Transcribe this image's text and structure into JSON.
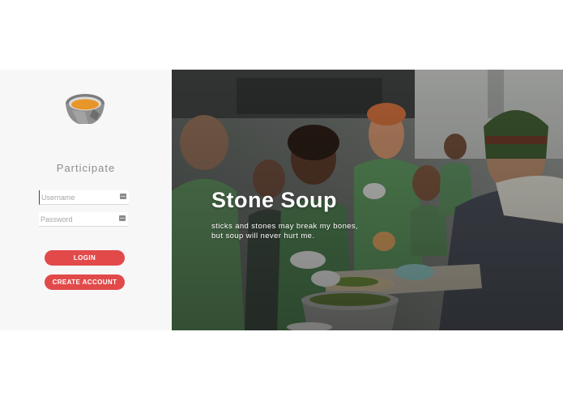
{
  "login": {
    "heading": "Participate",
    "username_placeholder": "Username",
    "password_placeholder": "Password",
    "login_label": "LOGIN",
    "create_account_label": "CREATE ACCOUNT"
  },
  "hero": {
    "title": "Stone Soup",
    "tagline_line1": "sticks and stones may break my bones,",
    "tagline_line2": "but soup will never hurt me."
  },
  "colors": {
    "accent": "#e24a4a",
    "soup": "#e8962a",
    "left_panel": "#f7f7f7"
  },
  "icons": {
    "logo": "soup-bowl-icon",
    "field_hint": "keyboard-icon"
  }
}
